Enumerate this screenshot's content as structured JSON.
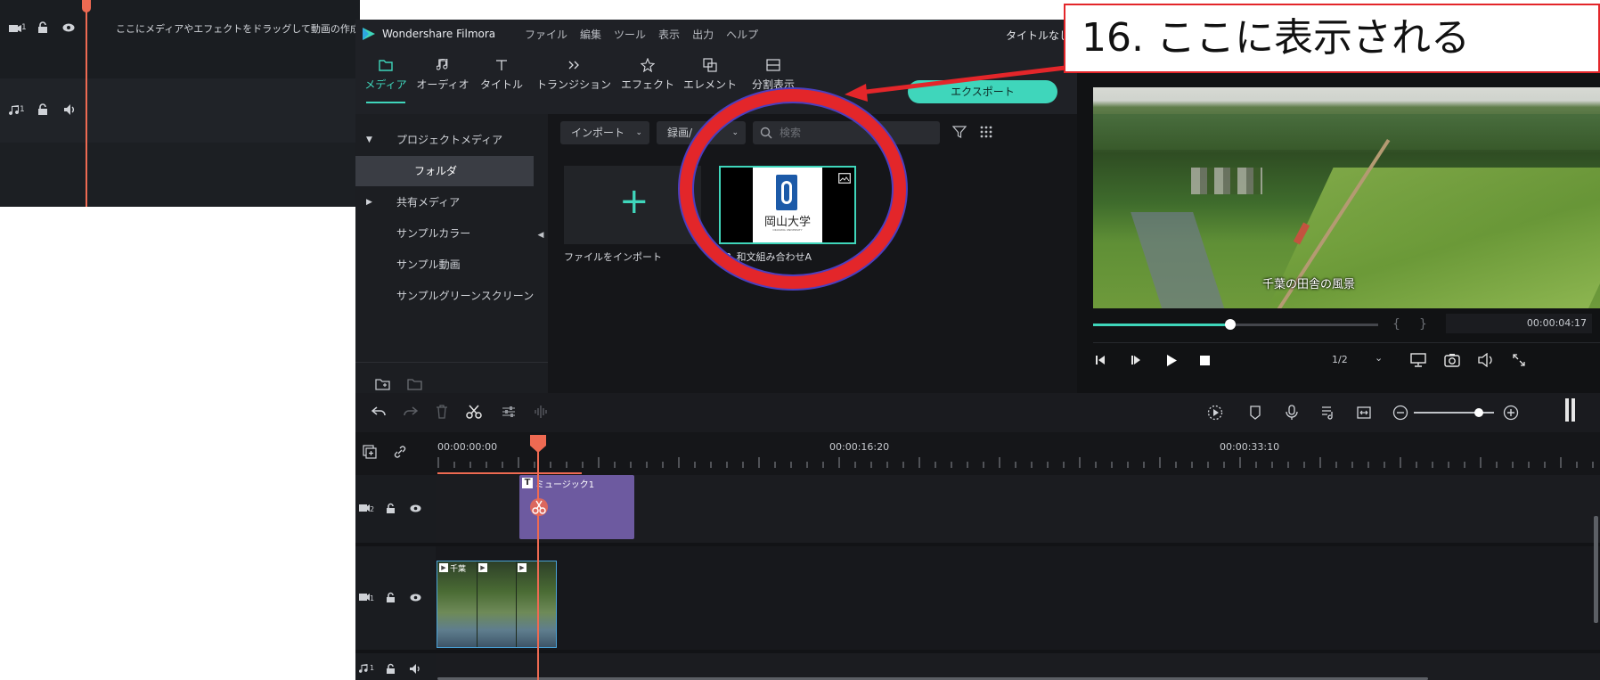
{
  "background_timeline": {
    "hint_text": "ここにメディアやエフェクトをドラッグして動画の作成を開",
    "video_track_label": "1",
    "audio_track_label": "1"
  },
  "app": {
    "name": "Wondershare Filmora",
    "menu": [
      "ファイル",
      "編集",
      "ツール",
      "表示",
      "出力",
      "ヘルプ"
    ],
    "project_title": "タイトルなし",
    "export_label": "エクスポート",
    "toolbar": [
      {
        "label": "メディア",
        "icon": "folder-icon",
        "active": true
      },
      {
        "label": "オーディオ",
        "icon": "music-note-icon",
        "active": false
      },
      {
        "label": "タイトル",
        "icon": "text-icon",
        "active": false
      },
      {
        "label": "トランジション",
        "icon": "transition-icon",
        "active": false
      },
      {
        "label": "エフェクト",
        "icon": "effects-icon",
        "active": false
      },
      {
        "label": "エレメント",
        "icon": "elements-icon",
        "active": false
      },
      {
        "label": "分割表示",
        "icon": "split-screen-icon",
        "active": false
      }
    ],
    "sidebar": [
      {
        "label": "プロジェクトメディア",
        "expander": "▼"
      },
      {
        "label": "フォルダ",
        "selected": true
      },
      {
        "label": "共有メディア",
        "expander": "▶"
      },
      {
        "label": "サンプルカラー"
      },
      {
        "label": "サンプル動画"
      },
      {
        "label": "サンプルグリーンスクリーン"
      }
    ],
    "media": {
      "import_dropdown": "インポート",
      "record_dropdown": "録画/",
      "search_placeholder": "検索",
      "import_tile_label": "ファイルをインポート",
      "item_label": "03_和文組み合わせA",
      "item_logo_text": "岡山大学",
      "item_logo_subtext": "OKAYAMA UNIVERSITY"
    },
    "preview": {
      "subtitle": "千葉の田舎の風景",
      "progress": 0.48,
      "timecode": "00:00:04:17",
      "quality": "1/2",
      "bracket_open": "{",
      "bracket_close": "}"
    },
    "timeline": {
      "ruler_marks": [
        "00:00:00:00",
        "00:00:16:20",
        "00:00:33:10"
      ],
      "title_clip_label": "ミュージック1",
      "title_clip_prefix": "T",
      "video_clip_label": "千葉",
      "track_numbers": [
        "2",
        "1",
        "1"
      ]
    }
  },
  "annotation": {
    "callout_text": "16. ここに表示される"
  },
  "colors": {
    "accent": "#3fd6bb",
    "playhead": "#ee6a52",
    "annotation_red": "#e3262a",
    "title_clip": "#6d5aa0"
  }
}
